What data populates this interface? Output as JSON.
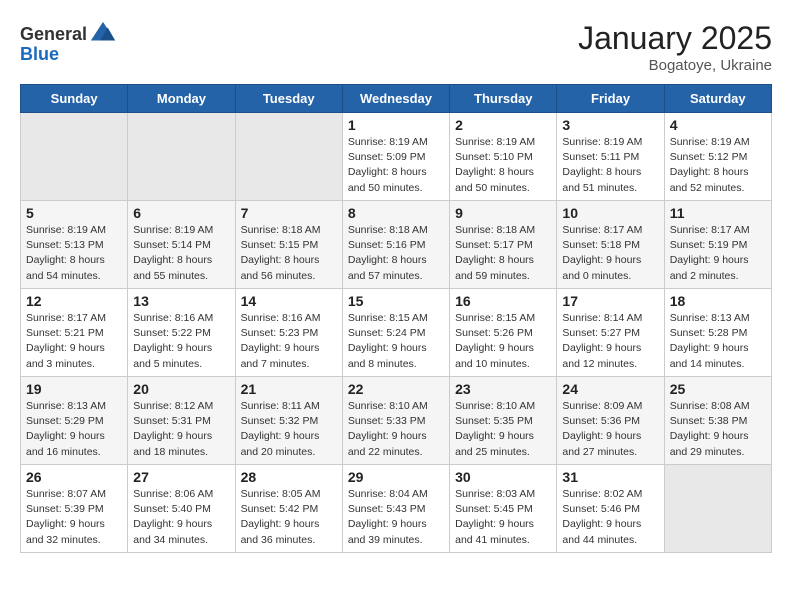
{
  "header": {
    "logo_general": "General",
    "logo_blue": "Blue",
    "month_year": "January 2025",
    "location": "Bogatoye, Ukraine"
  },
  "weekdays": [
    "Sunday",
    "Monday",
    "Tuesday",
    "Wednesday",
    "Thursday",
    "Friday",
    "Saturday"
  ],
  "weeks": [
    [
      {
        "day": "",
        "info": ""
      },
      {
        "day": "",
        "info": ""
      },
      {
        "day": "",
        "info": ""
      },
      {
        "day": "1",
        "info": "Sunrise: 8:19 AM\nSunset: 5:09 PM\nDaylight: 8 hours\nand 50 minutes."
      },
      {
        "day": "2",
        "info": "Sunrise: 8:19 AM\nSunset: 5:10 PM\nDaylight: 8 hours\nand 50 minutes."
      },
      {
        "day": "3",
        "info": "Sunrise: 8:19 AM\nSunset: 5:11 PM\nDaylight: 8 hours\nand 51 minutes."
      },
      {
        "day": "4",
        "info": "Sunrise: 8:19 AM\nSunset: 5:12 PM\nDaylight: 8 hours\nand 52 minutes."
      }
    ],
    [
      {
        "day": "5",
        "info": "Sunrise: 8:19 AM\nSunset: 5:13 PM\nDaylight: 8 hours\nand 54 minutes."
      },
      {
        "day": "6",
        "info": "Sunrise: 8:19 AM\nSunset: 5:14 PM\nDaylight: 8 hours\nand 55 minutes."
      },
      {
        "day": "7",
        "info": "Sunrise: 8:18 AM\nSunset: 5:15 PM\nDaylight: 8 hours\nand 56 minutes."
      },
      {
        "day": "8",
        "info": "Sunrise: 8:18 AM\nSunset: 5:16 PM\nDaylight: 8 hours\nand 57 minutes."
      },
      {
        "day": "9",
        "info": "Sunrise: 8:18 AM\nSunset: 5:17 PM\nDaylight: 8 hours\nand 59 minutes."
      },
      {
        "day": "10",
        "info": "Sunrise: 8:17 AM\nSunset: 5:18 PM\nDaylight: 9 hours\nand 0 minutes."
      },
      {
        "day": "11",
        "info": "Sunrise: 8:17 AM\nSunset: 5:19 PM\nDaylight: 9 hours\nand 2 minutes."
      }
    ],
    [
      {
        "day": "12",
        "info": "Sunrise: 8:17 AM\nSunset: 5:21 PM\nDaylight: 9 hours\nand 3 minutes."
      },
      {
        "day": "13",
        "info": "Sunrise: 8:16 AM\nSunset: 5:22 PM\nDaylight: 9 hours\nand 5 minutes."
      },
      {
        "day": "14",
        "info": "Sunrise: 8:16 AM\nSunset: 5:23 PM\nDaylight: 9 hours\nand 7 minutes."
      },
      {
        "day": "15",
        "info": "Sunrise: 8:15 AM\nSunset: 5:24 PM\nDaylight: 9 hours\nand 8 minutes."
      },
      {
        "day": "16",
        "info": "Sunrise: 8:15 AM\nSunset: 5:26 PM\nDaylight: 9 hours\nand 10 minutes."
      },
      {
        "day": "17",
        "info": "Sunrise: 8:14 AM\nSunset: 5:27 PM\nDaylight: 9 hours\nand 12 minutes."
      },
      {
        "day": "18",
        "info": "Sunrise: 8:13 AM\nSunset: 5:28 PM\nDaylight: 9 hours\nand 14 minutes."
      }
    ],
    [
      {
        "day": "19",
        "info": "Sunrise: 8:13 AM\nSunset: 5:29 PM\nDaylight: 9 hours\nand 16 minutes."
      },
      {
        "day": "20",
        "info": "Sunrise: 8:12 AM\nSunset: 5:31 PM\nDaylight: 9 hours\nand 18 minutes."
      },
      {
        "day": "21",
        "info": "Sunrise: 8:11 AM\nSunset: 5:32 PM\nDaylight: 9 hours\nand 20 minutes."
      },
      {
        "day": "22",
        "info": "Sunrise: 8:10 AM\nSunset: 5:33 PM\nDaylight: 9 hours\nand 22 minutes."
      },
      {
        "day": "23",
        "info": "Sunrise: 8:10 AM\nSunset: 5:35 PM\nDaylight: 9 hours\nand 25 minutes."
      },
      {
        "day": "24",
        "info": "Sunrise: 8:09 AM\nSunset: 5:36 PM\nDaylight: 9 hours\nand 27 minutes."
      },
      {
        "day": "25",
        "info": "Sunrise: 8:08 AM\nSunset: 5:38 PM\nDaylight: 9 hours\nand 29 minutes."
      }
    ],
    [
      {
        "day": "26",
        "info": "Sunrise: 8:07 AM\nSunset: 5:39 PM\nDaylight: 9 hours\nand 32 minutes."
      },
      {
        "day": "27",
        "info": "Sunrise: 8:06 AM\nSunset: 5:40 PM\nDaylight: 9 hours\nand 34 minutes."
      },
      {
        "day": "28",
        "info": "Sunrise: 8:05 AM\nSunset: 5:42 PM\nDaylight: 9 hours\nand 36 minutes."
      },
      {
        "day": "29",
        "info": "Sunrise: 8:04 AM\nSunset: 5:43 PM\nDaylight: 9 hours\nand 39 minutes."
      },
      {
        "day": "30",
        "info": "Sunrise: 8:03 AM\nSunset: 5:45 PM\nDaylight: 9 hours\nand 41 minutes."
      },
      {
        "day": "31",
        "info": "Sunrise: 8:02 AM\nSunset: 5:46 PM\nDaylight: 9 hours\nand 44 minutes."
      },
      {
        "day": "",
        "info": ""
      }
    ]
  ]
}
